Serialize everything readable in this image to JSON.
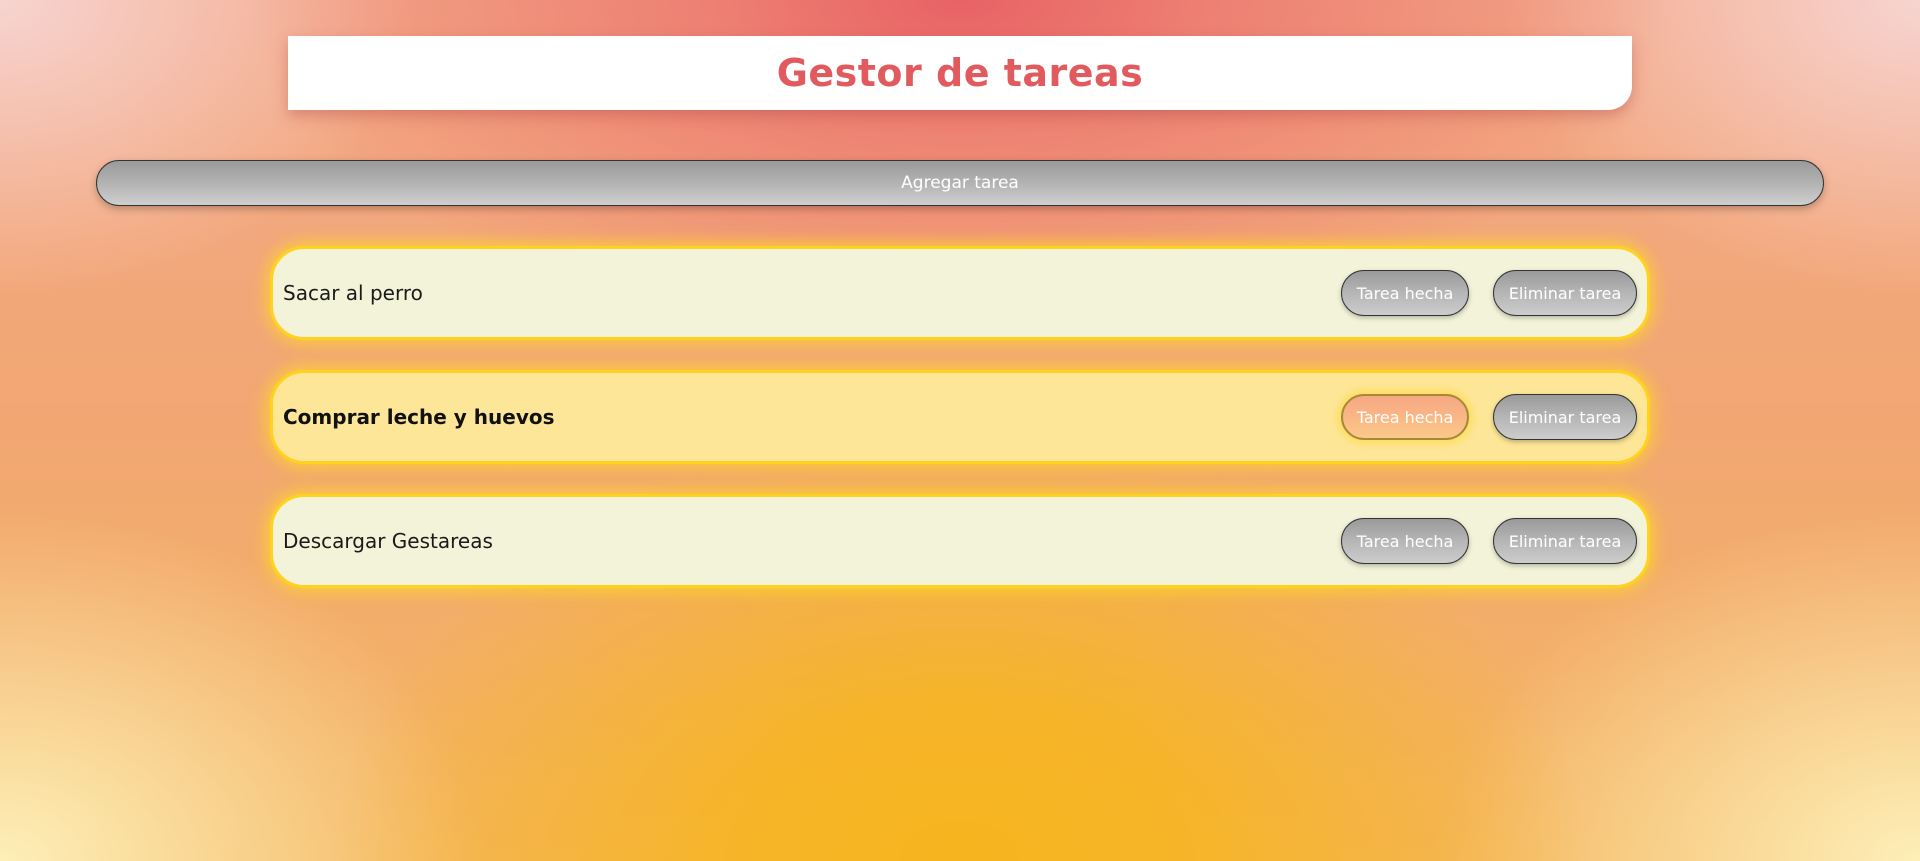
{
  "header": {
    "title": "Gestor de tareas"
  },
  "toolbar": {
    "add_label": "Agregar tarea"
  },
  "tasks": [
    {
      "text": "Sacar al perro",
      "done_label": "Tarea hecha",
      "delete_label": "Eliminar tarea",
      "done": false
    },
    {
      "text": "Comprar leche y huevos",
      "done_label": "Tarea hecha",
      "delete_label": "Eliminar tarea",
      "done": true
    },
    {
      "text": "Descargar Gestareas",
      "done_label": "Tarea hecha",
      "delete_label": "Eliminar tarea",
      "done": false
    }
  ],
  "colors": {
    "title": "#e15b5e",
    "task_bg": "#f2f3d8",
    "task_done_bg": "#fde697",
    "task_border": "#ffd21f"
  }
}
